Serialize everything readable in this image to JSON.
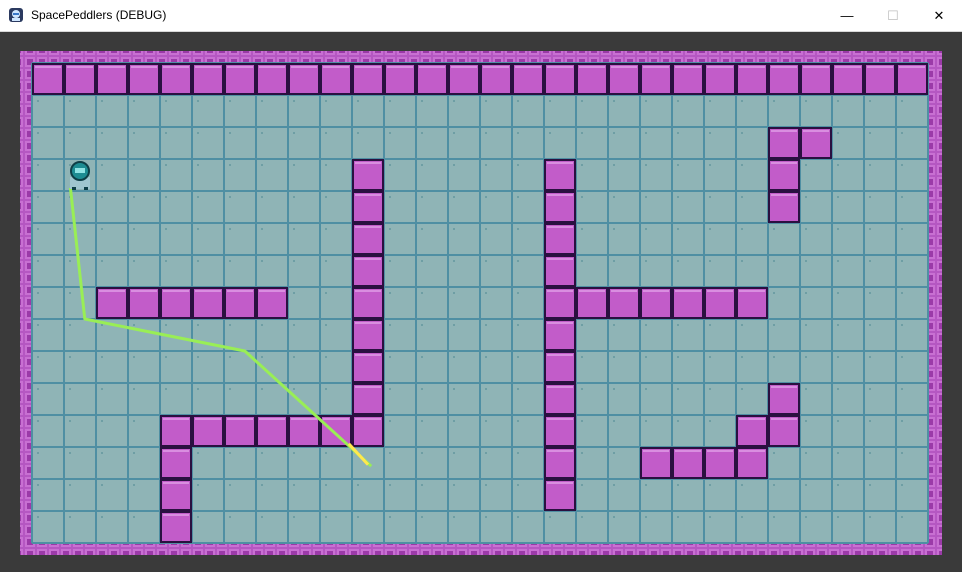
{
  "window": {
    "title": "SpacePeddlers (DEBUG)",
    "minimize_glyph": "—",
    "maximize_glyph": "☐",
    "close_glyph": "✕"
  },
  "colors": {
    "background": "#3a3a3a",
    "border": "#b557c2",
    "floor": "#8fb4b6",
    "floor_line": "#4f8fa3",
    "wall": "#c25cc9",
    "wall_outline": "#2a1040",
    "path": "#99ee55",
    "path_highlight": "#ffe84d",
    "player": "#1d8c92"
  },
  "icons": {
    "app": "app-icon",
    "player": "astronaut-sprite"
  },
  "map": {
    "cols": 28,
    "rows": 14,
    "walls": [
      [
        0,
        0
      ],
      [
        1,
        0
      ],
      [
        2,
        0
      ],
      [
        3,
        0
      ],
      [
        4,
        0
      ],
      [
        5,
        0
      ],
      [
        6,
        0
      ],
      [
        7,
        0
      ],
      [
        8,
        0
      ],
      [
        9,
        0
      ],
      [
        10,
        0
      ],
      [
        11,
        0
      ],
      [
        12,
        0
      ],
      [
        13,
        0
      ],
      [
        14,
        0
      ],
      [
        15,
        0
      ],
      [
        16,
        0
      ],
      [
        17,
        0
      ],
      [
        18,
        0
      ],
      [
        19,
        0
      ],
      [
        20,
        0
      ],
      [
        21,
        0
      ],
      [
        22,
        0
      ],
      [
        23,
        0
      ],
      [
        24,
        0
      ],
      [
        25,
        0
      ],
      [
        26,
        0
      ],
      [
        27,
        0
      ],
      [
        23,
        2
      ],
      [
        24,
        2
      ],
      [
        23,
        3
      ],
      [
        23,
        4
      ],
      [
        10,
        3
      ],
      [
        10,
        4
      ],
      [
        10,
        5
      ],
      [
        10,
        6
      ],
      [
        10,
        7
      ],
      [
        10,
        8
      ],
      [
        10,
        9
      ],
      [
        10,
        10
      ],
      [
        10,
        11
      ],
      [
        16,
        3
      ],
      [
        16,
        4
      ],
      [
        16,
        5
      ],
      [
        16,
        6
      ],
      [
        16,
        7
      ],
      [
        16,
        8
      ],
      [
        16,
        9
      ],
      [
        16,
        10
      ],
      [
        16,
        11
      ],
      [
        16,
        12
      ],
      [
        16,
        13
      ],
      [
        2,
        7
      ],
      [
        3,
        7
      ],
      [
        4,
        7
      ],
      [
        5,
        7
      ],
      [
        6,
        7
      ],
      [
        7,
        7
      ],
      [
        17,
        7
      ],
      [
        18,
        7
      ],
      [
        19,
        7
      ],
      [
        20,
        7
      ],
      [
        21,
        7
      ],
      [
        22,
        7
      ],
      [
        4,
        11
      ],
      [
        5,
        11
      ],
      [
        6,
        11
      ],
      [
        7,
        11
      ],
      [
        8,
        11
      ],
      [
        9,
        11
      ],
      [
        4,
        12
      ],
      [
        4,
        13
      ],
      [
        4,
        14
      ],
      [
        23,
        10
      ],
      [
        22,
        11
      ],
      [
        23,
        11
      ],
      [
        19,
        12
      ],
      [
        20,
        12
      ],
      [
        21,
        12
      ],
      [
        22,
        12
      ]
    ],
    "player_cell": [
      1,
      3
    ],
    "path": [
      [
        1.2,
        3.9
      ],
      [
        1.65,
        8.0
      ],
      [
        6.65,
        9.0
      ],
      [
        10.6,
        12.6
      ]
    ],
    "path_highlight_segment": [
      [
        9.9,
        11.9
      ],
      [
        10.5,
        12.55
      ]
    ]
  }
}
